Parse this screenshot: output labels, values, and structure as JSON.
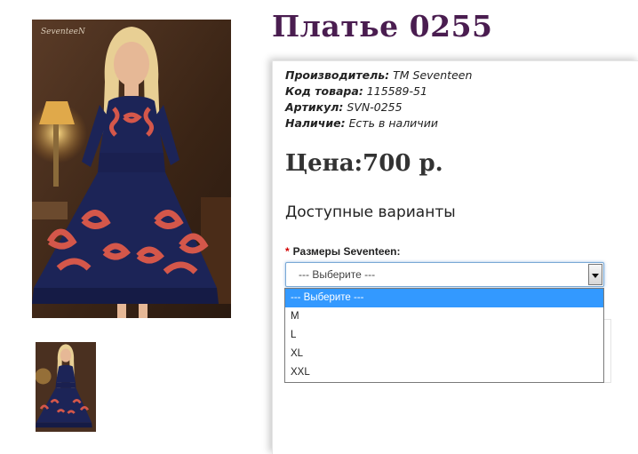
{
  "product": {
    "title": "Платье 0255",
    "image_watermark": "SeventeeN"
  },
  "meta": {
    "manufacturer_label": "Производитель:",
    "manufacturer_value": "ТМ Seventeen",
    "code_label": "Код товара:",
    "code_value": "115589-51",
    "article_label": "Артикул:",
    "article_value": "SVN-0255",
    "availability_label": "Наличие:",
    "availability_value": "Есть в наличии"
  },
  "price": {
    "text": "Цена:700 р."
  },
  "options": {
    "heading": "Доступные варианты",
    "required_mark": "*",
    "size_label": "Размеры Seventeen:",
    "selected_value": "--- Выберите ---",
    "items": [
      "--- Выберите ---",
      "M",
      "L",
      "XL",
      "XXL"
    ]
  },
  "colors": {
    "title": "#4a1d50",
    "dress_navy": "#1c2457",
    "dress_pattern": "#d4574a",
    "highlight": "#3399ff"
  }
}
